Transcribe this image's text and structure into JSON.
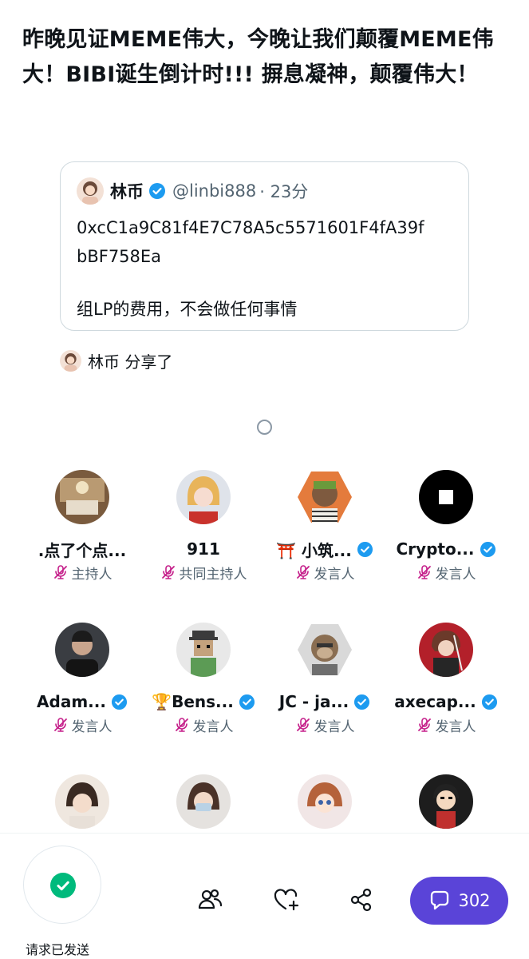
{
  "headline": "昨晚见证MEME伟大，今晚让我们颠覆MEME伟大！BIBI诞生倒计时!!! 摒息凝神，颠覆伟大！",
  "quote": {
    "name": "林币",
    "handle": "@linbi888",
    "time": "· 23分",
    "line1": "0xcC1a9C81f4E7C78A5c5571601F4fA39f",
    "line2": "bBF758Ea",
    "line3": "组LP的费用，不会做任何事情"
  },
  "shared": {
    "text": "林币 分享了"
  },
  "speakers": [
    {
      "name": ".点了个点...",
      "role": "主持人",
      "verified": false
    },
    {
      "name": "911",
      "role": "共同主持人",
      "verified": false
    },
    {
      "name": "⛩️ 小筑...",
      "role": "发言人",
      "verified": true
    },
    {
      "name": "Crypto...",
      "role": "发言人",
      "verified": true
    },
    {
      "name": "Adam...",
      "role": "发言人",
      "verified": true
    },
    {
      "name": "🏆Bens...",
      "role": "发言人",
      "verified": true
    },
    {
      "name": "JC - ja...",
      "role": "发言人",
      "verified": true
    },
    {
      "name": "axecap...",
      "role": "发言人",
      "verified": true
    }
  ],
  "bottom": {
    "request_label": "请求已发送",
    "chat_count": "302",
    "icons": [
      "people-icon",
      "heart-plus-icon",
      "share-icon",
      "chat-bubble-icon"
    ]
  },
  "colors": {
    "accent": "#5a44d8",
    "verified": "#1d9bf0",
    "mic_muted": "#c51f8a",
    "check": "#00ba7c"
  }
}
